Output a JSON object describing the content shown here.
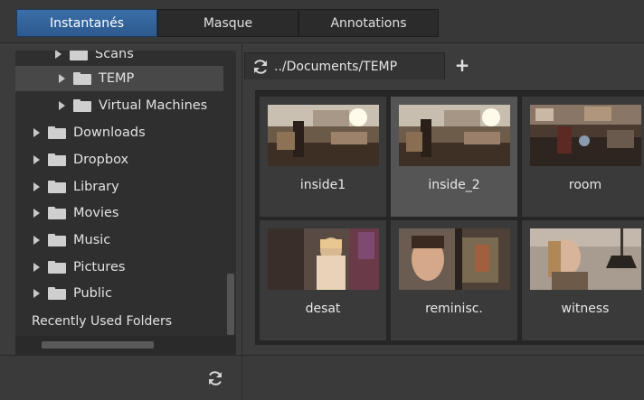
{
  "tabs": [
    {
      "label": "Instantanés",
      "active": true
    },
    {
      "label": "Masque",
      "active": false
    },
    {
      "label": "Annotations",
      "active": false
    }
  ],
  "tree": {
    "partial_top_item": "Scans",
    "items": [
      {
        "label": "TEMP",
        "level": 1,
        "selected": true
      },
      {
        "label": "Virtual Machines",
        "level": 1,
        "selected": false
      },
      {
        "label": "Downloads",
        "level": 0,
        "selected": false
      },
      {
        "label": "Dropbox",
        "level": 0,
        "selected": false
      },
      {
        "label": "Library",
        "level": 0,
        "selected": false
      },
      {
        "label": "Movies",
        "level": 0,
        "selected": false
      },
      {
        "label": "Music",
        "level": 0,
        "selected": false
      },
      {
        "label": "Pictures",
        "level": 0,
        "selected": false
      },
      {
        "label": "Public",
        "level": 0,
        "selected": false
      }
    ],
    "recent_label": "Recently Used Folders"
  },
  "browser": {
    "path": "../Documents/TEMP",
    "add_tab_icon": "plus-icon",
    "refresh_icon": "refresh-icon"
  },
  "thumbnails": [
    {
      "label": "inside1",
      "selected": false
    },
    {
      "label": "inside_2",
      "selected": true
    },
    {
      "label": "room",
      "selected": false
    },
    {
      "label": "desat",
      "selected": false
    },
    {
      "label": "reminisc.",
      "selected": false
    },
    {
      "label": "witness",
      "selected": false
    }
  ],
  "colors": {
    "accent": "#2d5a8e",
    "panel": "#2f2f2f",
    "selection": "#555555"
  }
}
